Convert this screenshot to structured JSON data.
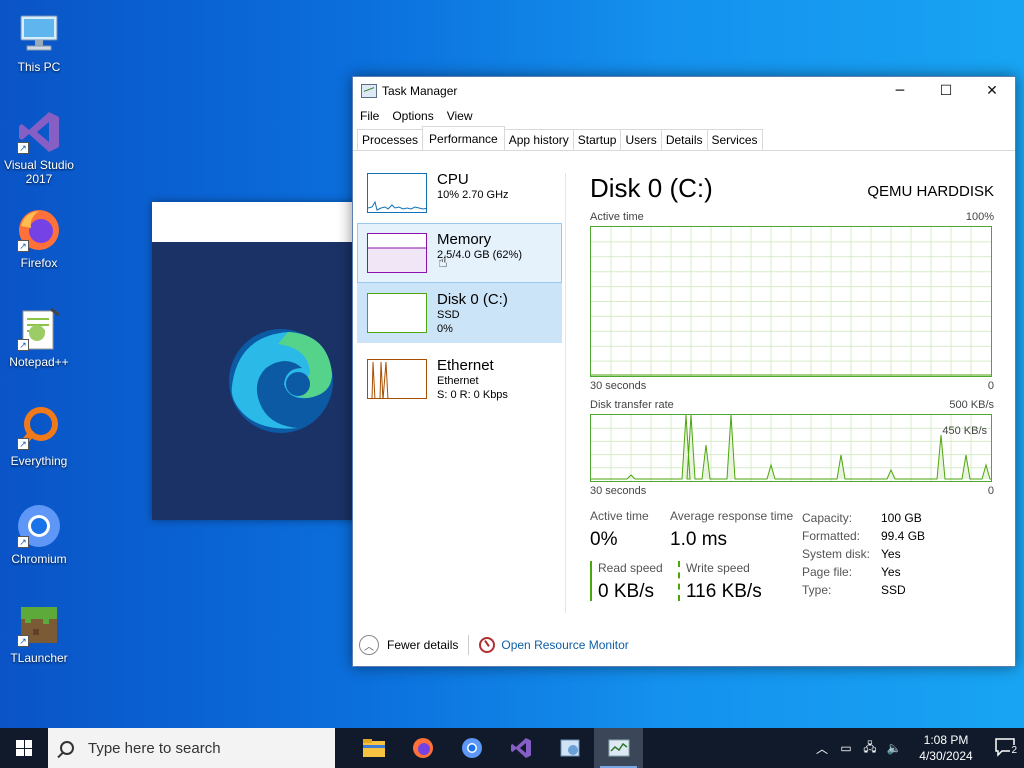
{
  "desktop": {
    "icons": [
      {
        "label": "This PC",
        "icon": "computer-icon"
      },
      {
        "label": "Visual Studio\n2017",
        "line1": "Visual Studio",
        "line2": "2017",
        "icon": "visual-studio-icon"
      },
      {
        "label": "Firefox",
        "icon": "firefox-icon"
      },
      {
        "label": "Notepad++",
        "icon": "notepadpp-icon"
      },
      {
        "label": "Everything",
        "icon": "everything-icon"
      },
      {
        "label": "Chromium",
        "icon": "chromium-icon"
      },
      {
        "label": "TLauncher",
        "icon": "tlauncher-icon"
      }
    ]
  },
  "taskmgr": {
    "title": "Task Manager",
    "menu": [
      "File",
      "Options",
      "View"
    ],
    "tabs": [
      "Processes",
      "Performance",
      "App history",
      "Startup",
      "Users",
      "Details",
      "Services"
    ],
    "active_tab": "Performance",
    "resources": [
      {
        "name": "CPU",
        "sub1": "10%  2.70 GHz",
        "sub2": "",
        "color": "#1171b6"
      },
      {
        "name": "Memory",
        "sub1": "2.5/4.0 GB (62%)",
        "sub2": "",
        "color": "#8b12ae"
      },
      {
        "name": "Disk 0 (C:)",
        "sub1": "SSD",
        "sub2": "0%",
        "color": "#4da60c"
      },
      {
        "name": "Ethernet",
        "sub1": "Ethernet",
        "sub2": "S: 0  R: 0 Kbps",
        "color": "#a74f01"
      }
    ],
    "detail": {
      "title": "Disk 0 (C:)",
      "model": "QEMU HARDDISK",
      "graph1": {
        "label": "Active time",
        "max": "100%",
        "time": "30 seconds",
        "min": "0"
      },
      "graph2": {
        "label": "Disk transfer rate",
        "max": "500 KB/s",
        "marker": "450 KB/s",
        "time": "30 seconds",
        "min": "0"
      },
      "active_time_label": "Active time",
      "active_time_value": "0%",
      "avg_resp_label": "Average response time",
      "avg_resp_value": "1.0 ms",
      "read_label": "Read speed",
      "read_value": "0 KB/s",
      "write_label": "Write speed",
      "write_value": "116 KB/s",
      "props": [
        {
          "k": "Capacity:",
          "v": "100 GB"
        },
        {
          "k": "Formatted:",
          "v": "99.4 GB"
        },
        {
          "k": "System disk:",
          "v": "Yes"
        },
        {
          "k": "Page file:",
          "v": "Yes"
        },
        {
          "k": "Type:",
          "v": "SSD"
        }
      ]
    },
    "footer": {
      "fewer": "Fewer details",
      "monitor": "Open Resource Monitor"
    }
  },
  "taskbar": {
    "search_placeholder": "Type here to search",
    "time": "1:08 PM",
    "date": "4/30/2024",
    "notifications": "2"
  },
  "colors": {
    "disk_green": "#4da60c",
    "accent": "#0f5fa8",
    "taskbar": "#101a2a"
  }
}
